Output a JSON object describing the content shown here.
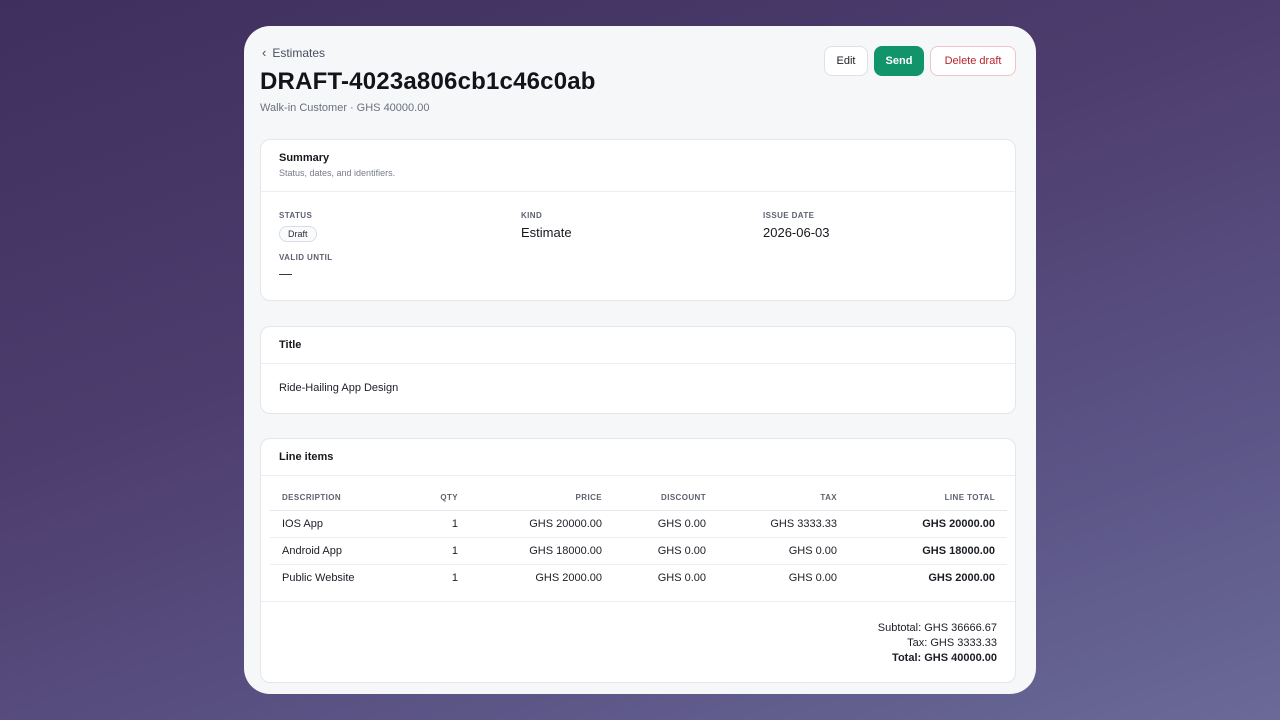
{
  "header": {
    "back_label": "Estimates",
    "title": "DRAFT-4023a806cb1c46c0ab",
    "customer": "Walk-in Customer",
    "separator": "·",
    "amount": "GHS 40000.00"
  },
  "actions": {
    "edit": "Edit",
    "send": "Send",
    "delete": "Delete draft"
  },
  "summary": {
    "title": "Summary",
    "description": "Status, dates, and identifiers.",
    "status_label": "STATUS",
    "status_value": "Draft",
    "kind_label": "KIND",
    "kind_value": "Estimate",
    "issue_date_label": "ISSUE DATE",
    "issue_date_value": "2026-06-03",
    "valid_until_label": "VALID UNTIL",
    "valid_until_value": "—"
  },
  "title_section": {
    "title": "Title",
    "value": "Ride-Hailing App Design"
  },
  "line_items": {
    "title": "Line items",
    "columns": [
      "DESCRIPTION",
      "QTY",
      "PRICE",
      "DISCOUNT",
      "TAX",
      "LINE TOTAL"
    ],
    "rows": [
      {
        "description": "IOS App",
        "qty": "1",
        "price": "GHS 20000.00",
        "discount": "GHS 0.00",
        "tax": "GHS 3333.33",
        "total": "GHS 20000.00"
      },
      {
        "description": "Android App",
        "qty": "1",
        "price": "GHS 18000.00",
        "discount": "GHS 0.00",
        "tax": "GHS 0.00",
        "total": "GHS 18000.00"
      },
      {
        "description": "Public Website",
        "qty": "1",
        "price": "GHS 2000.00",
        "discount": "GHS 0.00",
        "tax": "GHS 0.00",
        "total": "GHS 2000.00"
      }
    ],
    "subtotal": "Subtotal: GHS 36666.67",
    "tax": "Tax: GHS 3333.33",
    "total": "Total: GHS 40000.00"
  },
  "colors": {
    "send_button": "#12946a",
    "delete_text": "#b3262e"
  }
}
